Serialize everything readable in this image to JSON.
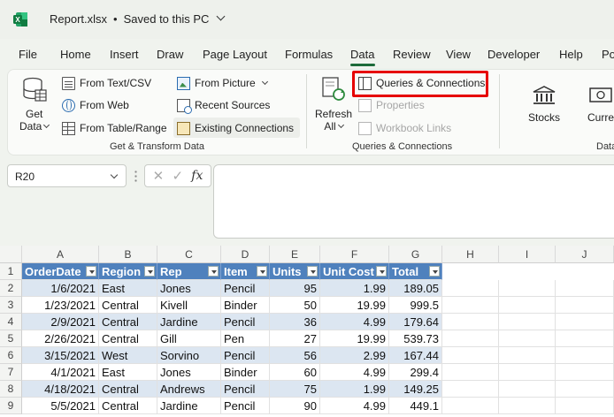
{
  "titlebar": {
    "filename": "Report.xlsx",
    "separator": "•",
    "save_status": "Saved to this PC"
  },
  "tabs": [
    "File",
    "Home",
    "Insert",
    "Draw",
    "Page Layout",
    "Formulas",
    "Data",
    "Review",
    "View",
    "Developer",
    "Help",
    "Po"
  ],
  "active_tab": "Data",
  "ribbon": {
    "get_transform": {
      "get_data": "Get",
      "get_data_line2": "Data",
      "from_text": "From Text/CSV",
      "from_web": "From Web",
      "from_table": "From Table/Range",
      "from_picture": "From Picture",
      "recent_sources": "Recent Sources",
      "existing_connections": "Existing Connections",
      "label": "Get & Transform Data"
    },
    "queries": {
      "refresh": "Refresh",
      "refresh_line2": "All",
      "queries_connections": "Queries & Connections",
      "properties": "Properties",
      "workbook_links": "Workbook Links",
      "label": "Queries & Connections"
    },
    "data_types": {
      "stocks": "Stocks",
      "currencies": "Curre",
      "label": "Data"
    }
  },
  "formula_bar": {
    "name_box": "R20",
    "fx": "fx",
    "cancel": "✕",
    "enter": "✓",
    "value": ""
  },
  "columns": [
    "A",
    "B",
    "C",
    "D",
    "E",
    "F",
    "G",
    "H",
    "I",
    "J"
  ],
  "rows": [
    "1",
    "2",
    "3",
    "4",
    "5",
    "6",
    "7",
    "8",
    "9"
  ],
  "table": {
    "headers": [
      "OrderDate",
      "Region",
      "Rep",
      "Item",
      "Units",
      "Unit Cost",
      "Total"
    ],
    "data": [
      [
        "1/6/2021",
        "East",
        "Jones",
        "Pencil",
        "95",
        "1.99",
        "189.05"
      ],
      [
        "1/23/2021",
        "Central",
        "Kivell",
        "Binder",
        "50",
        "19.99",
        "999.5"
      ],
      [
        "2/9/2021",
        "Central",
        "Jardine",
        "Pencil",
        "36",
        "4.99",
        "179.64"
      ],
      [
        "2/26/2021",
        "Central",
        "Gill",
        "Pen",
        "27",
        "19.99",
        "539.73"
      ],
      [
        "3/15/2021",
        "West",
        "Sorvino",
        "Pencil",
        "56",
        "2.99",
        "167.44"
      ],
      [
        "4/1/2021",
        "East",
        "Jones",
        "Binder",
        "60",
        "4.99",
        "299.4"
      ],
      [
        "4/18/2021",
        "Central",
        "Andrews",
        "Pencil",
        "75",
        "1.99",
        "149.25"
      ],
      [
        "5/5/2021",
        "Central",
        "Jardine",
        "Pencil",
        "90",
        "4.99",
        "449.1"
      ]
    ]
  },
  "colors": {
    "accent": "#1d6b3a",
    "table_header": "#4f81bd",
    "table_band": "#dce6f1",
    "highlight": "#e60000"
  }
}
